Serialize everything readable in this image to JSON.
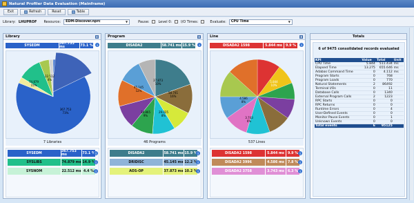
{
  "window": {
    "title": "Natural Profiler Data Evaluation (Mainframe)"
  },
  "toolbar": {
    "exit": "Exit",
    "refresh": "Refresh",
    "reset": "Reset",
    "table": "Table"
  },
  "filters": {
    "library_label": "Library:",
    "library_value": "LHUPROF",
    "resource_label": "Resource:",
    "resource_value": "EDM-Discover.nprc",
    "pause_label": "Pause:",
    "level0_label": "Level 0:",
    "io_label": "I/O Times:",
    "evaluate_label": "Evaluate:",
    "evaluate_value": "CPU Time"
  },
  "colors": {
    "selected_blue": "#2a62c9",
    "teal": "#3e7d8c",
    "red": "#d33",
    "header_navy": "#1f4e8f"
  },
  "library": {
    "title": "Library",
    "top": {
      "name": "SYSEDM",
      "time": "367.753 ms",
      "pct": "73.1 %"
    },
    "pie_labels": [
      {
        "id": "p1",
        "l1": "367.753",
        "l2": "73%"
      },
      {
        "id": "p2",
        "l1": "74.879",
        "l2": "15%"
      },
      {
        "id": "p3",
        "l1": "22.512",
        "l2": "4%"
      }
    ],
    "count": "7 Libraries",
    "rows": [
      {
        "name": "SYSEDM",
        "time": "367.753 ms",
        "pct": "73.1 %"
      },
      {
        "name": "SYSLIBS",
        "time": "74.879 ms",
        "pct": "14.9 %"
      },
      {
        "name": "SYSNOM",
        "time": "22.512 ms",
        "pct": "4.4 %"
      }
    ]
  },
  "program": {
    "title": "Program",
    "top": {
      "name": "DISADA2",
      "time": "58.741 ms",
      "pct": "15.9 %"
    },
    "pie_labels": [
      {
        "id": "p1",
        "l1": "58.741",
        "l2": "16%"
      },
      {
        "id": "p2",
        "l1": "45.145",
        "l2": "12%"
      },
      {
        "id": "p3",
        "l1": "37.873",
        "l2": "10%"
      },
      {
        "id": "p4",
        "l1": "29.025",
        "l2": "8%"
      },
      {
        "id": "p5",
        "l1": "34.865",
        "l2": "9%"
      }
    ],
    "count": "46 Programs",
    "rows": [
      {
        "name": "DISADA2",
        "time": "58.741 ms",
        "pct": "15.9 %"
      },
      {
        "name": "DRIDISC",
        "time": "45.145 ms",
        "pct": "12.2 %"
      },
      {
        "name": "AOS-OP",
        "time": "37.873 ms",
        "pct": "10.2 %"
      }
    ]
  },
  "line": {
    "title": "Line",
    "top": {
      "name": "DISADA2 1598",
      "time": "5.844 ms",
      "pct": "9.9 %"
    },
    "pie_labels": [
      {
        "id": "p1",
        "l1": "5.844",
        "l2": "10%"
      },
      {
        "id": "p2",
        "l1": "4.586",
        "l2": "8%"
      },
      {
        "id": "p3",
        "l1": "3.743",
        "l2": "6%"
      }
    ],
    "count": "537 Lines",
    "rows": [
      {
        "name": "DISADA2 1598",
        "time": "5.844 ms",
        "pct": "9.9 %"
      },
      {
        "name": "DISADA2 3996",
        "time": "4.586 ms",
        "pct": "7.8 %"
      },
      {
        "name": "DISADA2 3758",
        "time": "3.743 ms",
        "pct": "6.3 %"
      }
    ]
  },
  "totals": {
    "title": "Totals",
    "summary": "6 of 9475 consolidated records evaluated",
    "headers": [
      "KPI",
      "Value",
      "Total",
      "Unit"
    ],
    "rows": [
      [
        "CPU Time",
        "5.844",
        "511.434",
        "ms"
      ],
      [
        "Elapsed Time",
        "13.275",
        "655.646",
        "ms"
      ],
      [
        "Adabas Command Time",
        "0",
        "4.112",
        "ms"
      ],
      [
        "Program Starts",
        "0",
        "768",
        ""
      ],
      [
        "Program Loads",
        "0",
        "770",
        ""
      ],
      [
        "Natural Statements",
        "2",
        "86492",
        ""
      ],
      [
        "Terminal I/Os",
        "0",
        "11",
        ""
      ],
      [
        "Database Calls",
        "0",
        "1340",
        ""
      ],
      [
        "External Program Calls",
        "2",
        "1223",
        ""
      ],
      [
        "RPC Starts",
        "0",
        "0",
        ""
      ],
      [
        "RPC Returns",
        "0",
        "0",
        ""
      ],
      [
        "Runtime Errors",
        "0",
        "4",
        ""
      ],
      [
        "User-Defined Events",
        "0",
        "0",
        ""
      ],
      [
        "Monitor Pause Events",
        "0",
        "1",
        ""
      ],
      [
        "Unknown Events",
        "0",
        "0",
        ""
      ]
    ],
    "total_row": [
      "Total events",
      "6",
      "95125",
      ""
    ]
  }
}
